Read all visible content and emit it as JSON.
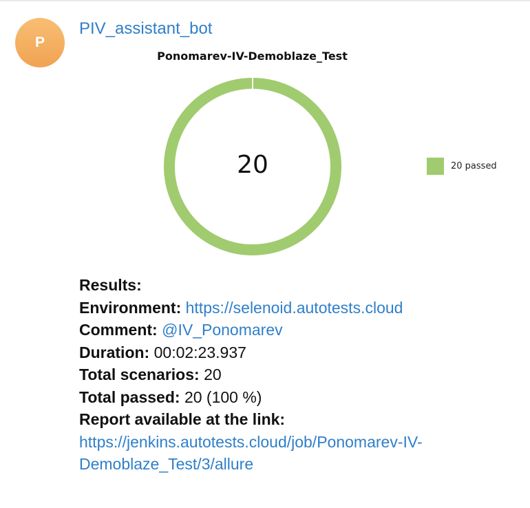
{
  "message": {
    "sender_name": "PIV_assistant_bot",
    "avatar_letter": "P"
  },
  "chart_data": {
    "type": "pie",
    "title": "Ponomarev-IV-Demoblaze_Test",
    "center_label": "20",
    "slices": [
      {
        "label": "20 passed",
        "value": 20,
        "color": "#a0cb6f"
      }
    ],
    "legend_placement": "right"
  },
  "results": {
    "header": "Results:",
    "environment_label": "Environment:",
    "environment_value": "https://selenoid.autotests.cloud",
    "comment_label": "Comment:",
    "comment_value": "@IV_Ponomarev",
    "duration_label": "Duration:",
    "duration_value": "00:02:23.937",
    "total_scenarios_label": "Total scenarios:",
    "total_scenarios_value": "20",
    "total_passed_label": "Total passed:",
    "total_passed_value": "20 (100 %)",
    "report_label": "Report available at the link:",
    "report_link": "https://jenkins.autotests.cloud/job/Ponomarev-IV-Demoblaze_Test/3/allure"
  },
  "colors": {
    "link": "#2f7fc9",
    "avatar": "#f0a352",
    "passed": "#a0cb6f"
  }
}
